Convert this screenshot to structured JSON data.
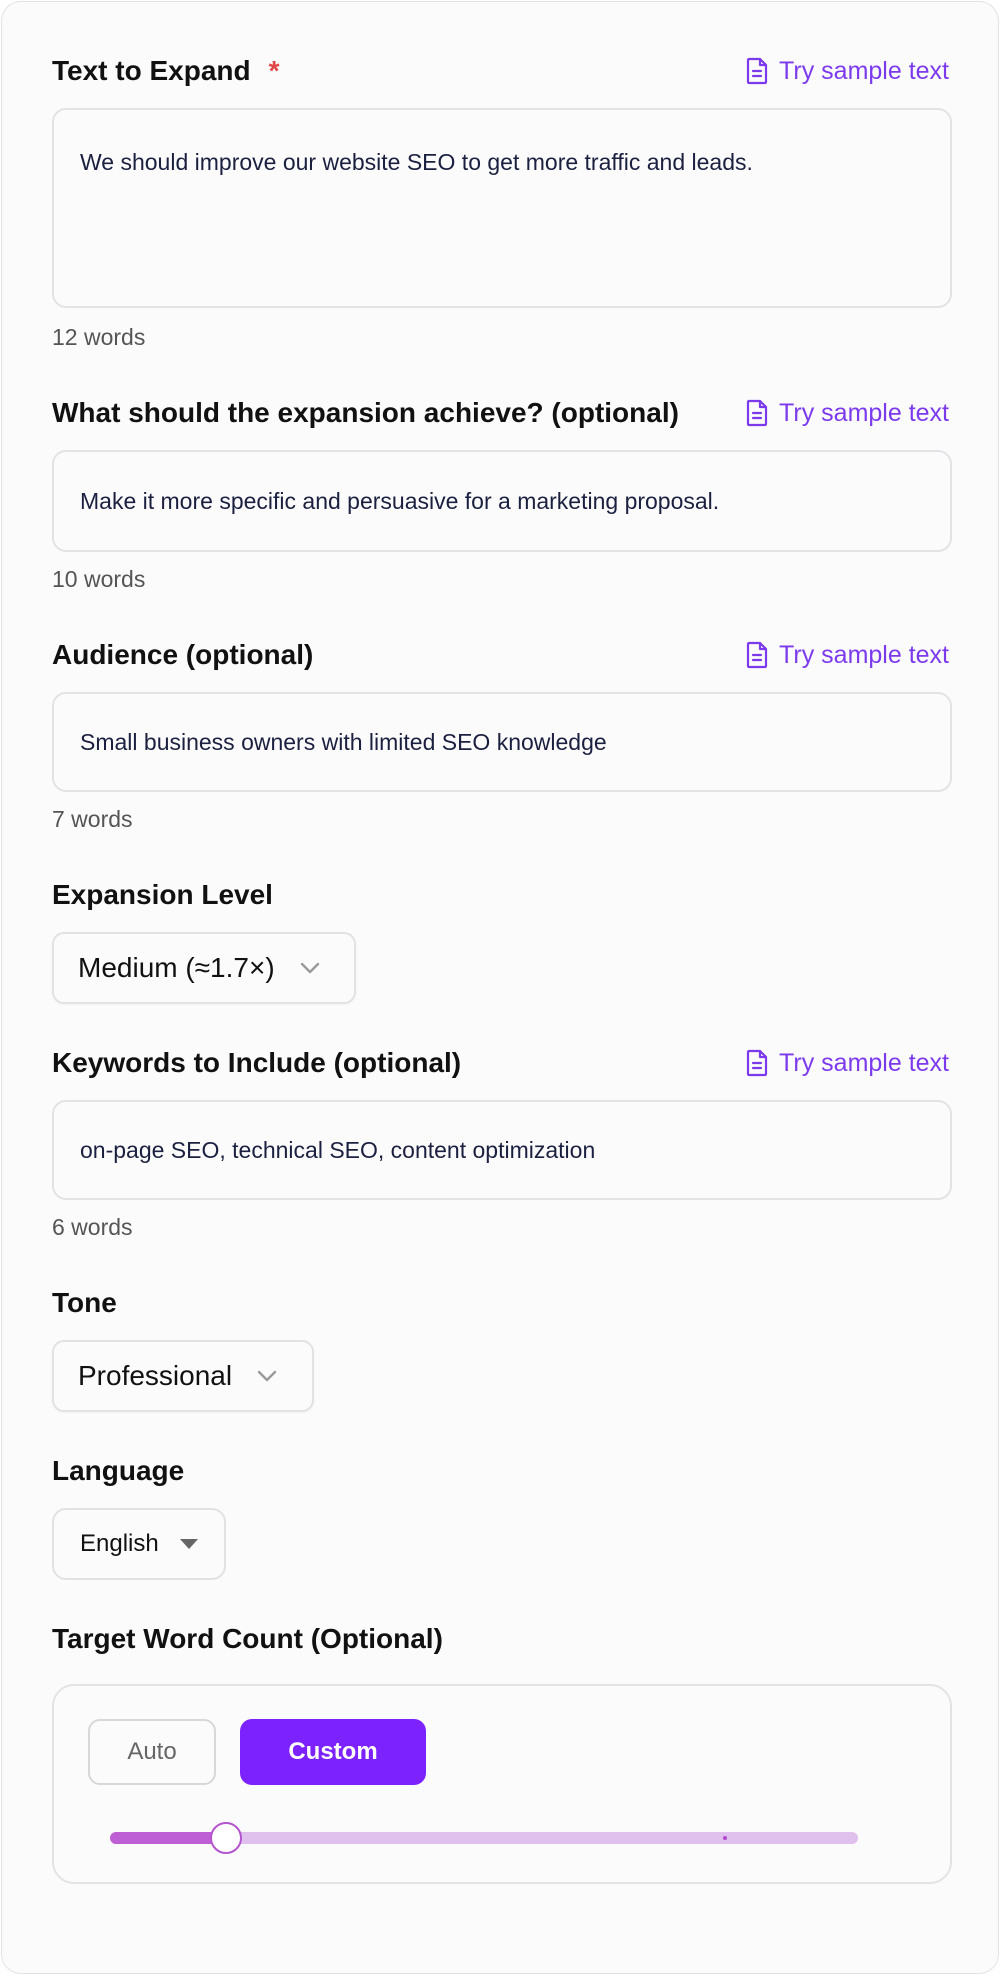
{
  "text_to_expand": {
    "label": "Text to Expand",
    "required_marker": "*",
    "sample_link": "Try sample text",
    "value": "We should improve our website SEO to get more traffic and leads.",
    "word_count": "12 words"
  },
  "goal": {
    "label": "What should the expansion achieve? (optional)",
    "sample_link": "Try sample text",
    "value": "Make it more specific and persuasive for a marketing proposal.",
    "word_count": "10 words"
  },
  "audience": {
    "label": "Audience (optional)",
    "sample_link": "Try sample text",
    "value": "Small business owners with limited SEO knowledge",
    "word_count": "7 words"
  },
  "expansion_level": {
    "label": "Expansion Level",
    "selected": "Medium (≈1.7×)"
  },
  "keywords": {
    "label": "Keywords to Include (optional)",
    "sample_link": "Try sample text",
    "value": "on-page SEO, technical SEO, content optimization",
    "word_count": "6 words"
  },
  "tone": {
    "label": "Tone",
    "selected": "Professional"
  },
  "language": {
    "label": "Language",
    "selected": "English"
  },
  "target_word_count": {
    "label": "Target Word Count (Optional)",
    "auto_label": "Auto",
    "custom_label": "Custom",
    "active_mode": "Custom",
    "slider_value_fraction": 0.155,
    "slider_marker_fraction": 0.82
  },
  "colors": {
    "accent": "#7c3aed",
    "primary_button": "#7c22ff",
    "required": "#e04545",
    "slider_fill": "#bf5fd6",
    "slider_track": "#e0c0ec"
  },
  "icons": {
    "sample_link_icon": "document-icon",
    "select_icon": "chevron-down-icon",
    "language_icon": "caret-down-icon"
  }
}
